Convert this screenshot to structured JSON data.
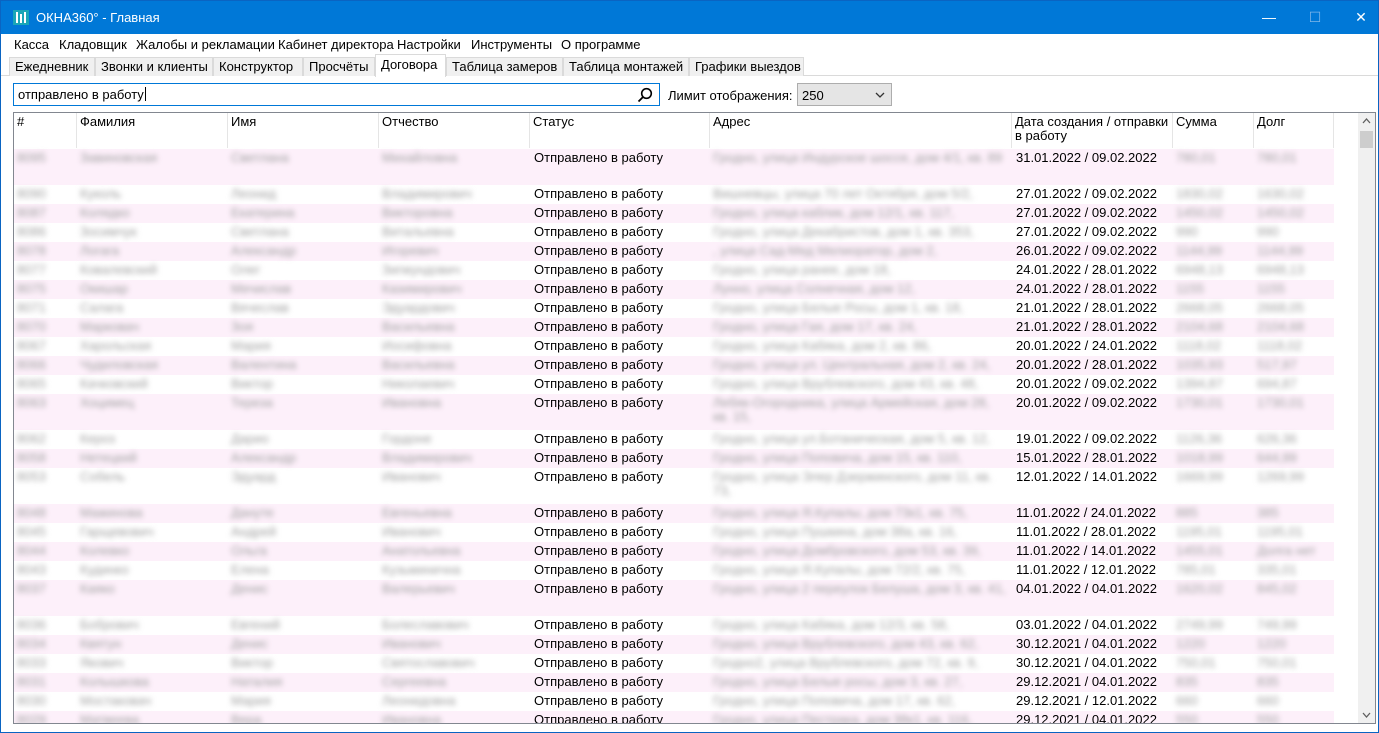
{
  "window": {
    "title": "ОКНА360° - Главная",
    "controls": {
      "minimize": "—",
      "maximize": "☐",
      "close": "✕"
    }
  },
  "menu": [
    {
      "label": "Касса"
    },
    {
      "label": "Кладовщик"
    },
    {
      "label": "Жалобы и рекламации"
    },
    {
      "label": "Кабинет директора"
    },
    {
      "label": "Настройки"
    },
    {
      "label": "Инструменты"
    },
    {
      "label": "О программе"
    }
  ],
  "tabs": [
    {
      "label": "Ежедневник",
      "active": false
    },
    {
      "label": "Звонки и клиенты",
      "active": false
    },
    {
      "label": "Конструктор",
      "active": false
    },
    {
      "label": "Просчёты",
      "active": false
    },
    {
      "label": "Договора",
      "active": true
    },
    {
      "label": "Таблица замеров",
      "active": false
    },
    {
      "label": "Таблица монтажей",
      "active": false
    },
    {
      "label": "Графики выездов",
      "active": false
    }
  ],
  "search": {
    "value": "отправлено в работу",
    "icon": "search-icon"
  },
  "limit": {
    "label": "Лимит отображения:",
    "value": "250"
  },
  "table": {
    "columns": [
      {
        "key": "num",
        "label": "#"
      },
      {
        "key": "last",
        "label": "Фамилия"
      },
      {
        "key": "first",
        "label": "Имя"
      },
      {
        "key": "middle",
        "label": "Отчество"
      },
      {
        "key": "status",
        "label": "Статус"
      },
      {
        "key": "address",
        "label": "Адрес"
      },
      {
        "key": "dates",
        "label": "Дата создания / отправки в работу"
      },
      {
        "key": "sum",
        "label": "Сумма"
      },
      {
        "key": "debt",
        "label": "Долг"
      }
    ],
    "rows": [
      {
        "num": "8095",
        "last": "Завиновская",
        "first": "Светлана",
        "middle": "Михайловна",
        "status": "Отправлено в работу",
        "address": "Гродно, улица Индурское шоссе, дом 4/1, кв. 89",
        "dates": "31.01.2022 / 09.02.2022",
        "sum": "780,01",
        "debt": "780,01",
        "tall": true,
        "pink": true
      },
      {
        "num": "8090",
        "last": "Куколь",
        "first": "Леонид",
        "middle": "Владимирович",
        "status": "Отправлено в работу",
        "address": "Вишневцы, улица 70 лет Октября, дом 5/2,",
        "dates": "27.01.2022 / 09.02.2022",
        "sum": "1830,02",
        "debt": "1630,02",
        "tall": false,
        "pink": false
      },
      {
        "num": "8087",
        "last": "Колядко",
        "first": "Екатерина",
        "middle": "Викторовна",
        "status": "Отправлено в работу",
        "address": "Гродно, улица каблик, дом 12/1, кв. 117,",
        "dates": "27.01.2022 / 09.02.2022",
        "sum": "1450,02",
        "debt": "1450,02",
        "tall": false,
        "pink": true
      },
      {
        "num": "8086",
        "last": "Зосимчук",
        "first": "Светлана",
        "middle": "Витальевна",
        "status": "Отправлено в работу",
        "address": "Гродно, улица Декабристов, дом 1, кв. 353,",
        "dates": "27.01.2022 / 09.02.2022",
        "sum": "990",
        "debt": "990",
        "tall": false,
        "pink": false
      },
      {
        "num": "8078",
        "last": "Логага",
        "first": "Александр",
        "middle": "Игоревич",
        "status": "Отправлено в работу",
        "address": ", улица Сад-Мед Мелиоратор, дом 2,",
        "dates": "26.01.2022 / 09.02.2022",
        "sum": "1144,99",
        "debt": "1144,99",
        "tall": false,
        "pink": true
      },
      {
        "num": "8077",
        "last": "Ковалевский",
        "first": "Олег",
        "middle": "Зигмундович",
        "status": "Отправлено в работу",
        "address": "Гродно, улица ранее, дом 18,",
        "dates": "24.01.2022 / 28.01.2022",
        "sum": "6948,13",
        "debt": "6948,13",
        "tall": false,
        "pink": false
      },
      {
        "num": "8075",
        "last": "Окишар",
        "first": "Мечислав",
        "middle": "Казимирович",
        "status": "Отправлено в работу",
        "address": "Лунно, улица Солнечная, дом 12,",
        "dates": "24.01.2022 / 28.01.2022",
        "sum": "1155",
        "debt": "1155",
        "tall": false,
        "pink": true
      },
      {
        "num": "8071",
        "last": "Салага",
        "first": "Вячеслав",
        "middle": "Эдуардович",
        "status": "Отправлено в работу",
        "address": "Гродно, улица Белые Росы, дом 1, кв. 18,",
        "dates": "21.01.2022 / 28.01.2022",
        "sum": "2668,05",
        "debt": "2668,05",
        "tall": false,
        "pink": false
      },
      {
        "num": "8070",
        "last": "Марковач",
        "first": "Зоя",
        "middle": "Васильевна",
        "status": "Отправлено в работу",
        "address": "Гродно, улица Гая, дом 17, кв. 24,",
        "dates": "21.01.2022 / 28.01.2022",
        "sum": "2104,68",
        "debt": "2104,68",
        "tall": false,
        "pink": true
      },
      {
        "num": "8067",
        "last": "Харольская",
        "first": "Мария",
        "middle": "Иосифовна",
        "status": "Отправлено в работу",
        "address": "Гродно, улица Кабяка, дом 2, кв. 86,",
        "dates": "20.01.2022 / 24.01.2022",
        "sum": "1118,02",
        "debt": "1118,02",
        "tall": false,
        "pink": false
      },
      {
        "num": "8066",
        "last": "Чудиловская",
        "first": "Валентина",
        "middle": "Васильевна",
        "status": "Отправлено в работу",
        "address": "Гродно, улица ул. Центральная, дом 2, кв. 24,",
        "dates": "20.01.2022 / 28.01.2022",
        "sum": "1035,93",
        "debt": "517,97",
        "tall": false,
        "pink": true
      },
      {
        "num": "8065",
        "last": "Качковский",
        "first": "Виктор",
        "middle": "Николаевич",
        "status": "Отправлено в работу",
        "address": "Гродно, улица Врублевского, дом 43, кв. 48,",
        "dates": "20.01.2022 / 09.02.2022",
        "sum": "1394,87",
        "debt": "694,87",
        "tall": false,
        "pink": false
      },
      {
        "num": "8063",
        "last": "Хоцимец",
        "first": "Тереза",
        "middle": "Ивановна",
        "status": "Отправлено в работу",
        "address": "Лебяк-Огородника, улица Армейская, дом 28, кв. 15,",
        "dates": "20.01.2022 / 09.02.2022",
        "sum": "1730,01",
        "debt": "1730,01",
        "tall": true,
        "pink": true
      },
      {
        "num": "8062",
        "last": "Кероз",
        "first": "Дарио",
        "middle": "Гордоне",
        "status": "Отправлено в работу",
        "address": "Гродно, улица ул.Ботаническая, дом 5, кв. 12,",
        "dates": "19.01.2022 / 09.02.2022",
        "sum": "1126,36",
        "debt": "626,36",
        "tall": false,
        "pink": false
      },
      {
        "num": "8058",
        "last": "Нетецкий",
        "first": "Александр",
        "middle": "Владимирович",
        "status": "Отправлено в работу",
        "address": "Гродно, улица Поповича, дом 15, кв. 110,",
        "dates": "15.01.2022 / 28.01.2022",
        "sum": "1018,99",
        "debt": "644,99",
        "tall": false,
        "pink": true
      },
      {
        "num": "8053",
        "last": "Собель",
        "first": "Эдуард",
        "middle": "Иванович",
        "status": "Отправлено в работу",
        "address": "Гродно, улица Элер Дзержинского, дом 11, кв. 73,",
        "dates": "12.01.2022 / 14.01.2022",
        "sum": "1669,99",
        "debt": "1269,99",
        "tall": true,
        "pink": false
      },
      {
        "num": "8048",
        "last": "Мажинова",
        "first": "Дануте",
        "middle": "Евгеньевна",
        "status": "Отправлено в работу",
        "address": "Гродно, улица Я.Купалы, дом 73к1, кв. 75,",
        "dates": "11.01.2022 / 24.01.2022",
        "sum": "885",
        "debt": "385",
        "tall": false,
        "pink": true
      },
      {
        "num": "8045",
        "last": "Гарщевович",
        "first": "Андрей",
        "middle": "Иванович",
        "status": "Отправлено в работу",
        "address": "Гродно, улица Пушкина, дом 38а, кв. 16,",
        "dates": "11.01.2022 / 28.01.2022",
        "sum": "1195,01",
        "debt": "1195,01",
        "tall": false,
        "pink": false
      },
      {
        "num": "8044",
        "last": "Колевко",
        "first": "Ольга",
        "middle": "Анатольевна",
        "status": "Отправлено в работу",
        "address": "Гродно, улица Домбровского, дом 53, кв. 39,",
        "dates": "11.01.2022 / 14.01.2022",
        "sum": "1455,01",
        "debt": "Долга нет",
        "tall": false,
        "pink": true
      },
      {
        "num": "8043",
        "last": "Кудинко",
        "first": "Елена",
        "middle": "Кузьминична",
        "status": "Отправлено в работу",
        "address": "Гродно, улица Я.Купалы, дом 72/2, кв. 75,",
        "dates": "11.01.2022 / 12.01.2022",
        "sum": "785,01",
        "debt": "335,01",
        "tall": false,
        "pink": false
      },
      {
        "num": "8037",
        "last": "Каяко",
        "first": "Денис",
        "middle": "Валерьевич",
        "status": "Отправлено в работу",
        "address": "Гродно, улица 2 переулок Белуша, дом 3, кв. 41,",
        "dates": "04.01.2022 / 04.01.2022",
        "sum": "1620,02",
        "debt": "845,02",
        "tall": true,
        "pink": true
      },
      {
        "num": "8036",
        "last": "Бобрович",
        "first": "Евгений",
        "middle": "Болеславович",
        "status": "Отправлено в работу",
        "address": "Гродно, улица Кабяка, дом 12/3, кв. 58,",
        "dates": "03.01.2022 / 04.01.2022",
        "sum": "2749,99",
        "debt": "749,99",
        "tall": false,
        "pink": false
      },
      {
        "num": "8034",
        "last": "Квятун",
        "first": "Денис",
        "middle": "Иванович",
        "status": "Отправлено в работу",
        "address": "Гродно, улица Врублевского, дом 43, кв. 62,",
        "dates": "30.12.2021 / 04.01.2022",
        "sum": "1220",
        "debt": "1220",
        "tall": false,
        "pink": true
      },
      {
        "num": "8033",
        "last": "Якович",
        "first": "Виктор",
        "middle": "Святославович",
        "status": "Отправлено в работу",
        "address": "Гродно2, улица Врублевского, дом 72, кв. 9,",
        "dates": "30.12.2021 / 04.01.2022",
        "sum": "750,01",
        "debt": "750,01",
        "tall": false,
        "pink": false
      },
      {
        "num": "8031",
        "last": "Колышкова",
        "first": "Наталия",
        "middle": "Сергеевна",
        "status": "Отправлено в работу",
        "address": "Гродно, улица Белые росы, дом 3, кв. 27,",
        "dates": "29.12.2021 / 04.01.2022",
        "sum": "835",
        "debt": "835",
        "tall": false,
        "pink": true
      },
      {
        "num": "8030",
        "last": "Мостаковач",
        "first": "Мария",
        "middle": "Леонидовна",
        "status": "Отправлено в работу",
        "address": "Гродно, улица Поповича, дом 17, кв. 62,",
        "dates": "29.12.2021 / 12.01.2022",
        "sum": "660",
        "debt": "660",
        "tall": false,
        "pink": false
      },
      {
        "num": "8029",
        "last": "Матвеева",
        "first": "Вера",
        "middle": "Ивановна",
        "status": "Отправлено в работу",
        "address": "Гродно, улица Пестрака, дом 38к1, кв. 116,",
        "dates": "29.12.2021 / 04.01.2022",
        "sum": "550",
        "debt": "550",
        "tall": false,
        "pink": true
      }
    ]
  },
  "colors": {
    "titlebar": "#0078d7",
    "row_alt": "#fdf0fa",
    "accent_border": "#0078d7"
  }
}
